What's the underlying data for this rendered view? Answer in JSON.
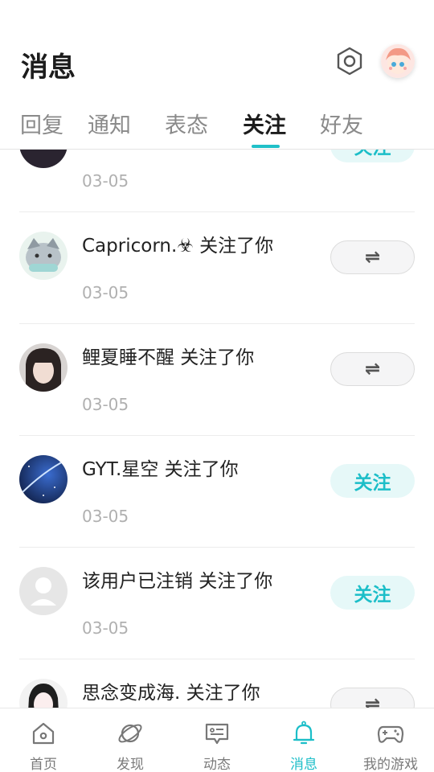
{
  "header": {
    "title": "消息"
  },
  "tabs": [
    {
      "label": "回复"
    },
    {
      "label": "通知"
    },
    {
      "label": "表态"
    },
    {
      "label": "关注"
    },
    {
      "label": "好友"
    }
  ],
  "active_tab": "关注",
  "notifications": [
    {
      "message": "",
      "date": "03-05",
      "button": "关注",
      "button_type": "follow"
    },
    {
      "message": "Capricorn.☣ 关注了你",
      "date": "03-05",
      "button": "⇌",
      "button_type": "mutual"
    },
    {
      "message": "鲤夏睡不醒 关注了你",
      "date": "03-05",
      "button": "⇌",
      "button_type": "mutual"
    },
    {
      "message": "GYT.星空 关注了你",
      "date": "03-05",
      "button": "关注",
      "button_type": "follow"
    },
    {
      "message": "该用户已注销 关注了你",
      "date": "03-05",
      "button": "关注",
      "button_type": "follow"
    },
    {
      "message": "思念变成海. 关注了你",
      "date": "",
      "button": "⇌",
      "button_type": "mutual"
    }
  ],
  "bottom_nav": [
    {
      "label": "首页",
      "icon": "home-icon"
    },
    {
      "label": "发现",
      "icon": "planet-icon"
    },
    {
      "label": "动态",
      "icon": "chat-card-icon"
    },
    {
      "label": "消息",
      "icon": "bell-icon"
    },
    {
      "label": "我的游戏",
      "icon": "gamepad-icon"
    }
  ],
  "colors": {
    "accent": "#1cbec8",
    "follow_bg": "#e6f8f8",
    "mutual_bg": "#f5f5f6"
  }
}
